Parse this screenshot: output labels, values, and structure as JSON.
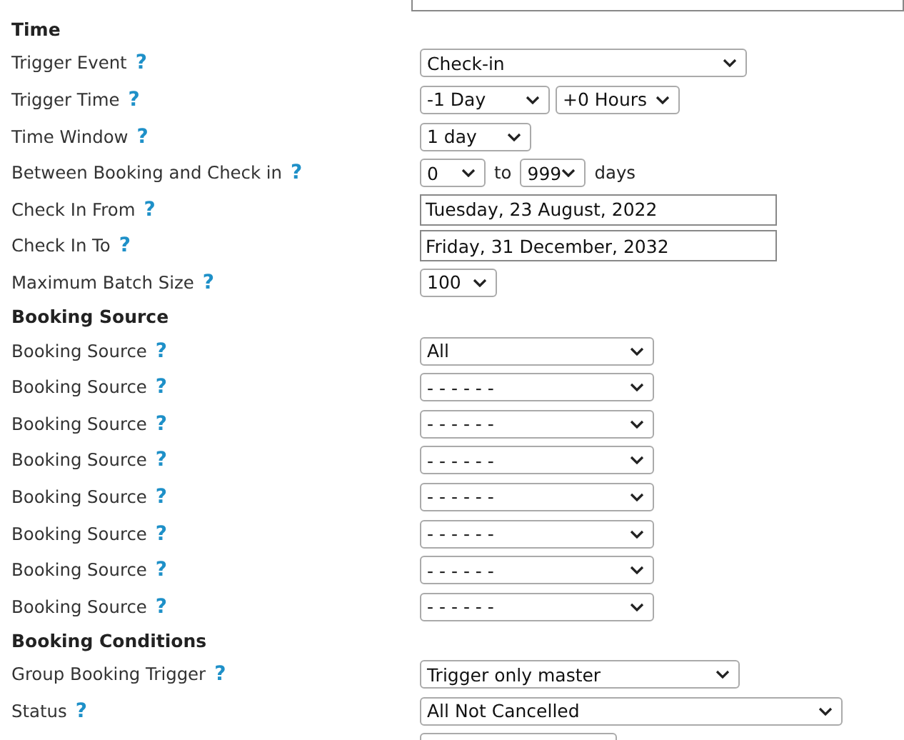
{
  "rows": [
    {
      "kind": "field",
      "controls": [
        {
          "kind": "input"
        }
      ]
    },
    {
      "kind": "section",
      "label": "Time"
    },
    {
      "kind": "field",
      "label": "Trigger Event",
      "help": "?",
      "controls": [
        {
          "kind": "select",
          "value": "Check-in"
        }
      ]
    },
    {
      "kind": "field",
      "label": "Trigger Time",
      "help": "?",
      "controls": [
        {
          "kind": "select",
          "value": "-1 Day"
        },
        {
          "kind": "select",
          "value": "+0 Hours"
        }
      ]
    },
    {
      "kind": "field",
      "label": "Time Window",
      "help": "?",
      "controls": [
        {
          "kind": "select",
          "value": "1 day"
        }
      ]
    },
    {
      "kind": "field",
      "label": "Between Booking and Check in",
      "help": "?",
      "controls": [
        {
          "kind": "select",
          "value": "0"
        },
        {
          "kind": "text",
          "value": "to"
        },
        {
          "kind": "select",
          "value": "999"
        },
        {
          "kind": "text",
          "value": "days"
        }
      ]
    },
    {
      "kind": "field",
      "label": "Check In From",
      "help": "?",
      "controls": [
        {
          "kind": "input",
          "value": "Tuesday, 23 August, 2022"
        }
      ]
    },
    {
      "kind": "field",
      "label": "Check In To",
      "help": "?",
      "controls": [
        {
          "kind": "input",
          "value": "Friday, 31 December, 2032"
        }
      ]
    },
    {
      "kind": "field",
      "label": "Maximum Batch Size",
      "help": "?",
      "controls": [
        {
          "kind": "select",
          "value": "100"
        }
      ]
    },
    {
      "kind": "section",
      "label": "Booking Source"
    },
    {
      "kind": "field",
      "label": "Booking Source",
      "help": "?",
      "controls": [
        {
          "kind": "select",
          "value": "All"
        }
      ]
    },
    {
      "kind": "field",
      "label": "Booking Source",
      "help": "?",
      "controls": [
        {
          "kind": "select",
          "value": "- - - - - -"
        }
      ]
    },
    {
      "kind": "field",
      "label": "Booking Source",
      "help": "?",
      "controls": [
        {
          "kind": "select",
          "value": "- - - - - -"
        }
      ]
    },
    {
      "kind": "field",
      "label": "Booking Source",
      "help": "?",
      "controls": [
        {
          "kind": "select",
          "value": "- - - - - -"
        }
      ]
    },
    {
      "kind": "field",
      "label": "Booking Source",
      "help": "?",
      "controls": [
        {
          "kind": "select",
          "value": "- - - - - -"
        }
      ]
    },
    {
      "kind": "field",
      "label": "Booking Source",
      "help": "?",
      "controls": [
        {
          "kind": "select",
          "value": "- - - - - -"
        }
      ]
    },
    {
      "kind": "field",
      "label": "Booking Source",
      "help": "?",
      "controls": [
        {
          "kind": "select",
          "value": "- - - - - -"
        }
      ]
    },
    {
      "kind": "field",
      "label": "Booking Source",
      "help": "?",
      "controls": [
        {
          "kind": "select",
          "value": "- - - - - -"
        }
      ]
    },
    {
      "kind": "section",
      "label": "Booking Conditions"
    },
    {
      "kind": "field",
      "label": "Group Booking Trigger",
      "help": "?",
      "controls": [
        {
          "kind": "select",
          "value": "Trigger only master"
        }
      ]
    },
    {
      "kind": "field",
      "label": "Status",
      "help": "?",
      "controls": [
        {
          "kind": "select",
          "value": "All Not Cancelled"
        }
      ]
    },
    {
      "kind": "field",
      "controls": [
        {
          "kind": "select"
        }
      ]
    }
  ]
}
